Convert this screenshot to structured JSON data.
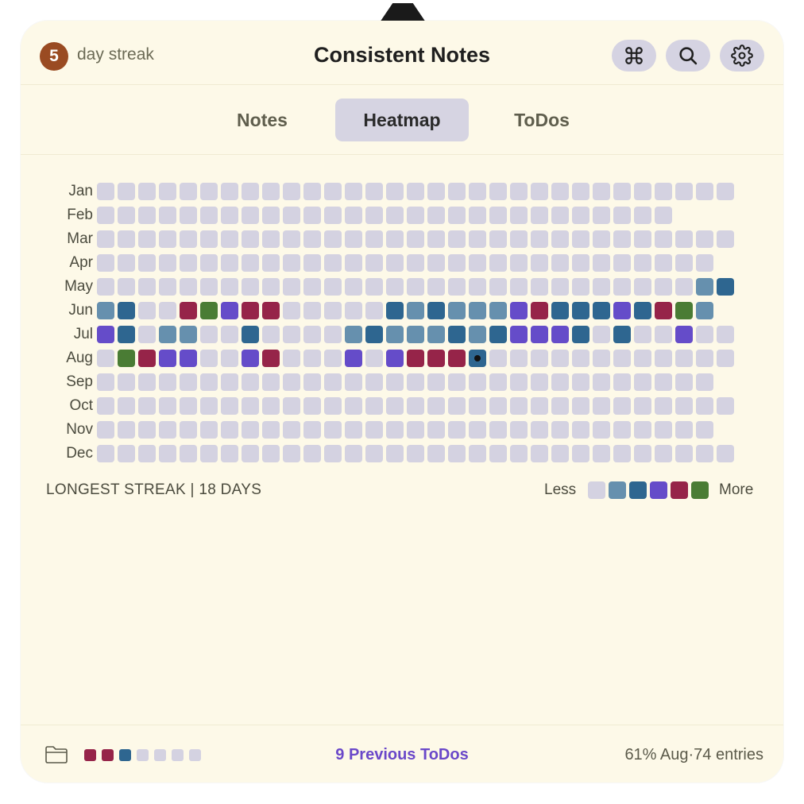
{
  "header": {
    "streak_count": "5",
    "streak_label": "day streak",
    "title": "Consistent Notes",
    "buttons": {
      "command": "command-icon",
      "search": "search-icon",
      "settings": "gear-icon"
    }
  },
  "tabs": [
    {
      "label": "Notes",
      "active": false
    },
    {
      "label": "Heatmap",
      "active": true
    },
    {
      "label": "ToDos",
      "active": false
    }
  ],
  "colors": {
    "0": "#d4d2e1",
    "1": "#6690ae",
    "2": "#2e6690",
    "3": "#654cc9",
    "4": "#962449",
    "5": "#4a7c34"
  },
  "heatmap": {
    "months": [
      {
        "label": "Jan",
        "days": 31,
        "levels": []
      },
      {
        "label": "Feb",
        "days": 28,
        "levels": []
      },
      {
        "label": "Mar",
        "days": 31,
        "levels": []
      },
      {
        "label": "Apr",
        "days": 30,
        "levels": []
      },
      {
        "label": "May",
        "days": 31,
        "levels": [
          0,
          0,
          0,
          0,
          0,
          0,
          0,
          0,
          0,
          0,
          0,
          0,
          0,
          0,
          0,
          0,
          0,
          0,
          0,
          0,
          0,
          0,
          0,
          0,
          0,
          0,
          0,
          0,
          0,
          1,
          2
        ]
      },
      {
        "label": "Jun",
        "days": 30,
        "levels": [
          1,
          2,
          0,
          0,
          4,
          5,
          3,
          4,
          4,
          0,
          0,
          0,
          0,
          0,
          2,
          1,
          2,
          1,
          1,
          1,
          3,
          4,
          2,
          2,
          2,
          3,
          2,
          4,
          5,
          1
        ]
      },
      {
        "label": "Jul",
        "days": 31,
        "levels": [
          3,
          2,
          0,
          1,
          1,
          0,
          0,
          2,
          0,
          0,
          0,
          0,
          1,
          2,
          1,
          1,
          1,
          2,
          1,
          2,
          3,
          3,
          3,
          2,
          0,
          2,
          0,
          0,
          3,
          0,
          0
        ]
      },
      {
        "label": "Aug",
        "days": 31,
        "levels": [
          0,
          5,
          4,
          3,
          3,
          0,
          0,
          3,
          4,
          0,
          0,
          0,
          3,
          0,
          3,
          4,
          4,
          4,
          2,
          0,
          0,
          0,
          0,
          0,
          0,
          0,
          0,
          0,
          0,
          0,
          0
        ]
      },
      {
        "label": "Sep",
        "days": 30,
        "levels": []
      },
      {
        "label": "Oct",
        "days": 31,
        "levels": []
      },
      {
        "label": "Nov",
        "days": 30,
        "levels": []
      },
      {
        "label": "Dec",
        "days": 31,
        "levels": []
      }
    ],
    "today": {
      "month": "Aug",
      "day": 19
    }
  },
  "longest_streak": "LONGEST STREAK | 18 DAYS",
  "legend": {
    "less": "Less",
    "more": "More",
    "levels": [
      0,
      1,
      2,
      3,
      4,
      5
    ]
  },
  "footer": {
    "folder_icon": "folder-icon",
    "week_levels": [
      4,
      4,
      2,
      0,
      0,
      0,
      0
    ],
    "previous_todos": "9 Previous ToDos",
    "stats": "61% Aug·74 entries"
  }
}
